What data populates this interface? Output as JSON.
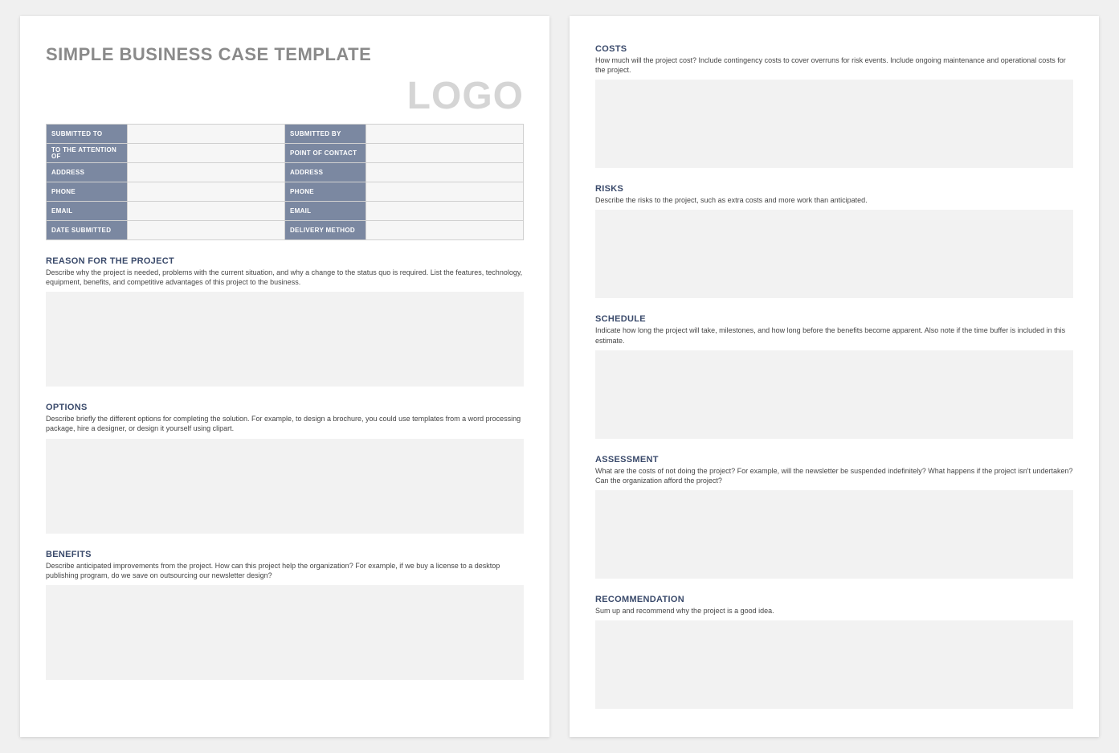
{
  "title": "SIMPLE BUSINESS CASE TEMPLATE",
  "logo": "LOGO",
  "info_rows": [
    {
      "l1": "SUBMITTED TO",
      "v1": "",
      "l2": "SUBMITTED BY",
      "v2": ""
    },
    {
      "l1": "TO THE ATTENTION OF",
      "v1": "",
      "l2": "POINT OF CONTACT",
      "v2": ""
    },
    {
      "l1": "ADDRESS",
      "v1": "",
      "l2": "ADDRESS",
      "v2": ""
    },
    {
      "l1": "PHONE",
      "v1": "",
      "l2": "PHONE",
      "v2": ""
    },
    {
      "l1": "EMAIL",
      "v1": "",
      "l2": "EMAIL",
      "v2": ""
    },
    {
      "l1": "DATE SUBMITTED",
      "v1": "",
      "l2": "DELIVERY METHOD",
      "v2": ""
    }
  ],
  "sections_p1": [
    {
      "h": "REASON FOR THE PROJECT",
      "d": "Describe why the project is needed, problems with the current situation, and why a change to the status quo is required. List the features, technology, equipment, benefits, and competitive advantages of this project to the business."
    },
    {
      "h": "OPTIONS",
      "d": "Describe briefly the different options for completing the solution. For example, to design a brochure, you could use templates from a word processing package, hire a designer, or design it yourself using clipart."
    },
    {
      "h": "BENEFITS",
      "d": "Describe anticipated improvements from the project. How can this project help the organization? For example, if we buy a license to a desktop publishing program, do we save on outsourcing our newsletter design?"
    }
  ],
  "sections_p2": [
    {
      "h": "COSTS",
      "d": "How much will the project cost? Include contingency costs to cover overruns for risk events. Include ongoing maintenance and operational costs for the project."
    },
    {
      "h": "RISKS",
      "d": "Describe the risks to the project, such as extra costs and more work than anticipated."
    },
    {
      "h": "SCHEDULE",
      "d": "Indicate how long the project will take, milestones, and how long before the benefits become apparent. Also note if the time buffer is included in this estimate."
    },
    {
      "h": "ASSESSMENT",
      "d": "What are the costs of not doing the project? For example, will the newsletter be suspended indefinitely? What happens if the project isn't undertaken? Can the organization afford the project?"
    },
    {
      "h": "RECOMMENDATION",
      "d": "Sum up and recommend why the project is a good idea."
    }
  ]
}
